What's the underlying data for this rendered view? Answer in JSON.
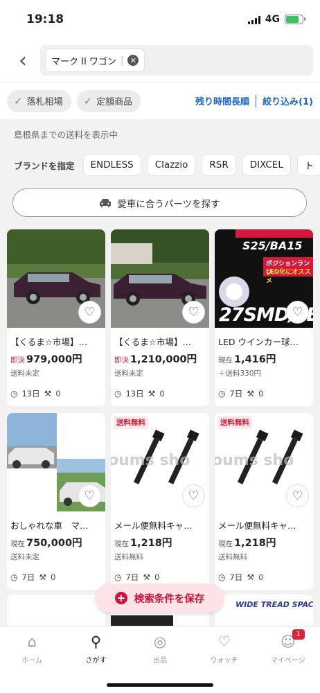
{
  "status": {
    "time": "19:18",
    "network": "4G"
  },
  "search": {
    "chip": "マーク II ワゴン"
  },
  "filters": {
    "chips": [
      "落札相場",
      "定額商品"
    ],
    "sort_label": "残り時間長順",
    "refine_label": "絞り込み(1)"
  },
  "shipping_note": "島根県までの送料を表示中",
  "brands": {
    "label": "ブランドを指定",
    "items": [
      "ENDLESS",
      "Clazzio",
      "RSR",
      "DIXCEL",
      "ト"
    ]
  },
  "parts_button": "愛車に合うパーツを探す",
  "items": [
    {
      "title": "【くるま☆市場】…",
      "price_label": "即決",
      "price": "979,000円",
      "shipping": "送料未定",
      "days": "13日",
      "bids": "0",
      "buy_now": true,
      "free_ship": false
    },
    {
      "title": "【くるま☆市場】…",
      "price_label": "即決",
      "price": "1,210,000円",
      "shipping": "送料未定",
      "days": "13日",
      "bids": "0",
      "buy_now": true,
      "free_ship": false
    },
    {
      "title": "LED ウインカー球…",
      "price_label": "現在",
      "price": "1,416円",
      "shipping": "＋送料330円",
      "days": "7日",
      "bids": "0",
      "buy_now": false,
      "free_ship": false
    },
    {
      "title": "おしゃれな車　マ…",
      "price_label": "現在",
      "price": "750,000円",
      "shipping": "送料未定",
      "days": "7日",
      "bids": "0",
      "buy_now": false,
      "free_ship": false
    },
    {
      "title": "メール便無料キャ…",
      "price_label": "現在",
      "price": "1,218円",
      "shipping": "送料無料",
      "days": "7日",
      "bids": "0",
      "buy_now": false,
      "free_ship": true
    },
    {
      "title": "メール便無料キャ…",
      "price_label": "現在",
      "price": "1,218円",
      "shipping": "送料無料",
      "days": "7日",
      "bids": "0",
      "buy_now": false,
      "free_ship": true
    }
  ],
  "free_ship_badge": "送料無料",
  "thumb_text": {
    "led_title": "S25/BA15",
    "led_sub1": "ポジションランプ",
    "led_sub2": "LED化にオススメ",
    "led_big": "27SMD/LE",
    "watermark": "oums sho",
    "peek_text": "WIDE TREAD SPAC"
  },
  "save_search": "検索条件を保存",
  "tabbar": {
    "tabs": [
      "ホーム",
      "さがす",
      "出品",
      "ウォッチ",
      "マイページ"
    ],
    "badge": "1"
  }
}
